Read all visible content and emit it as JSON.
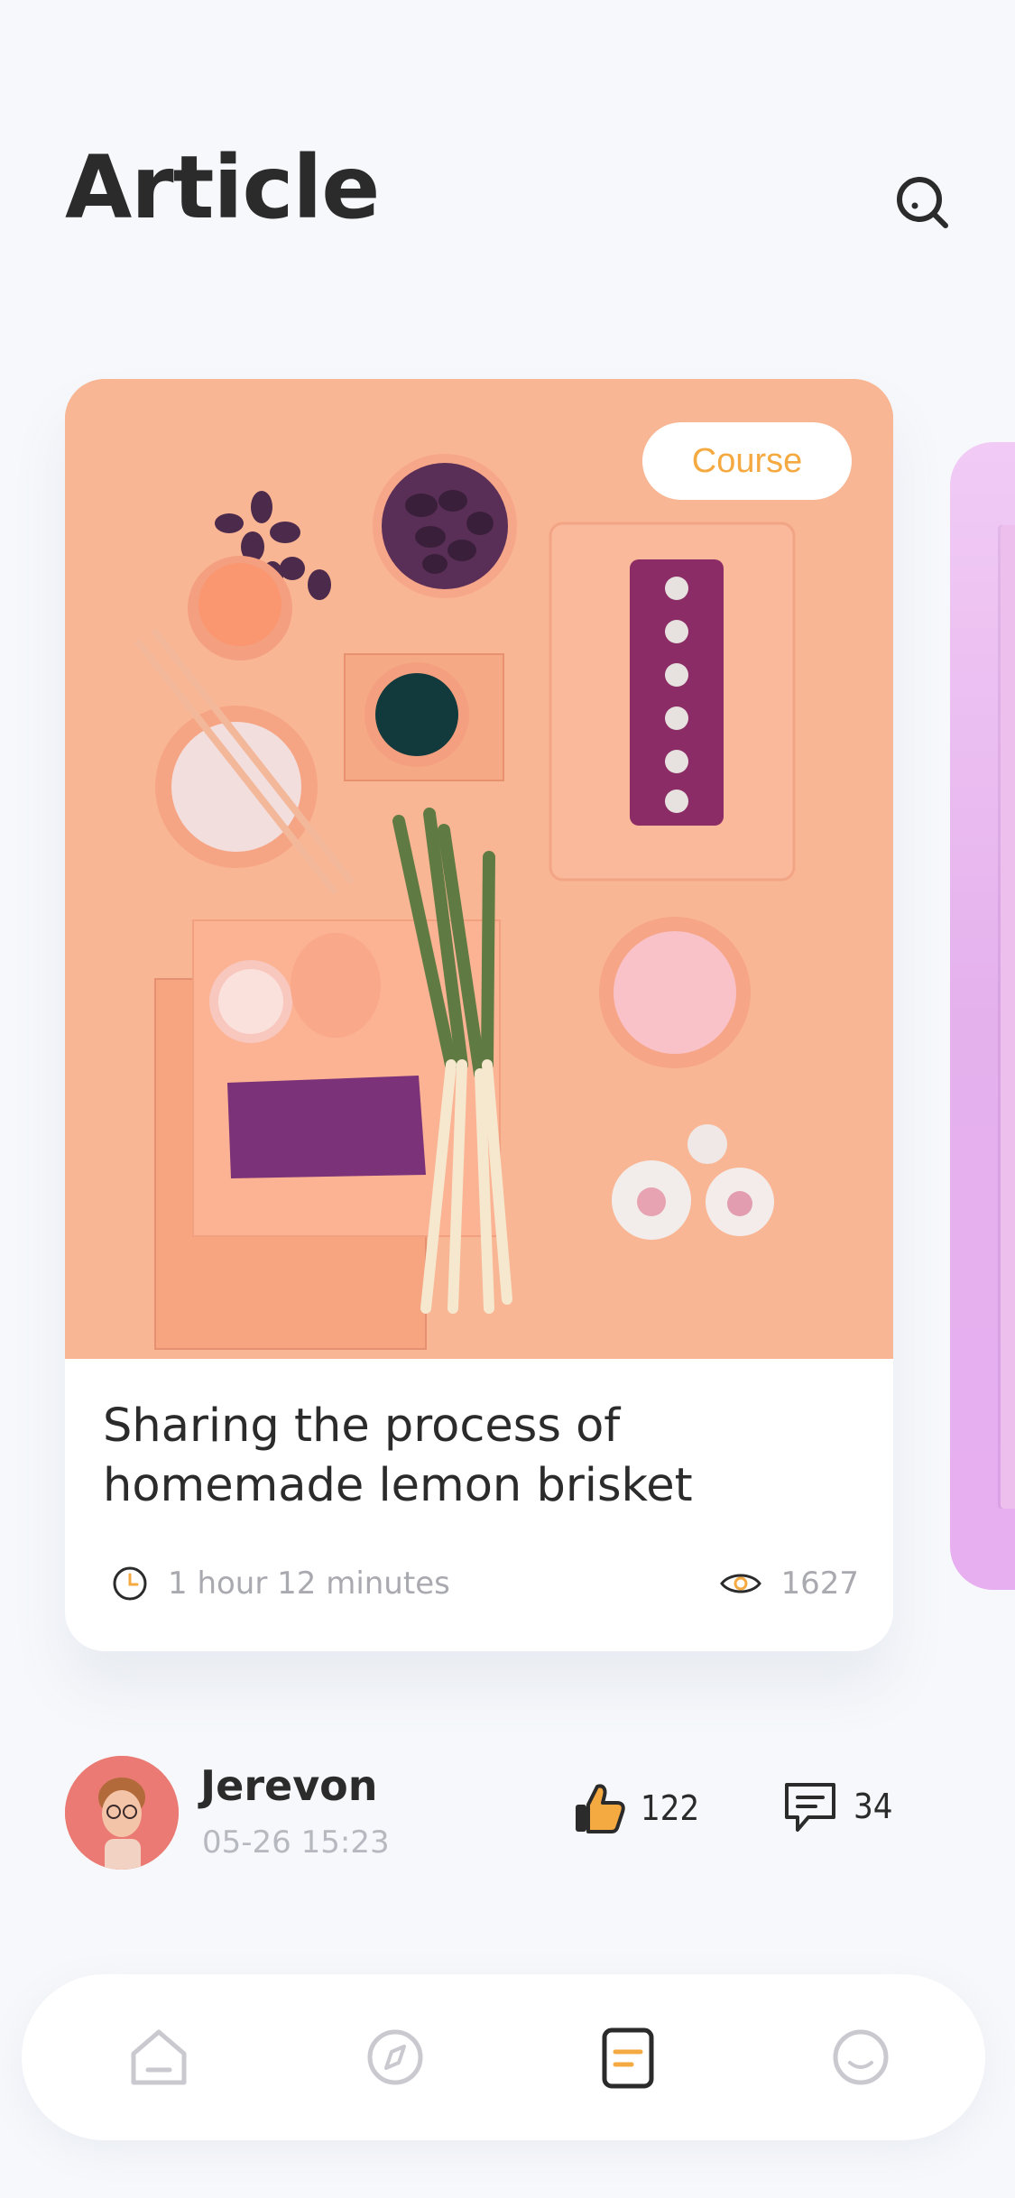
{
  "header": {
    "title": "Article",
    "search_icon": "search-icon"
  },
  "article": {
    "badge": "Course",
    "title": "Sharing the process of homemade lemon brisket",
    "duration": "1 hour 12 minutes",
    "views": "1627",
    "image_description_icon": "food-flatlay-image"
  },
  "author": {
    "name": "Jerevon",
    "timestamp": "05-26 15:23",
    "likes": "122",
    "comments": "34"
  },
  "tabbar": {
    "items": [
      {
        "name": "home",
        "icon": "home-icon",
        "active": false
      },
      {
        "name": "discover",
        "icon": "compass-icon",
        "active": false
      },
      {
        "name": "article",
        "icon": "article-icon",
        "active": true
      },
      {
        "name": "profile",
        "icon": "smile-icon",
        "active": false
      }
    ]
  },
  "colors": {
    "accent": "#f5a941",
    "text": "#2b2b2b",
    "muted": "#a9a9b0",
    "image_bg": "#f9b694",
    "peek": "#e7aef0"
  }
}
